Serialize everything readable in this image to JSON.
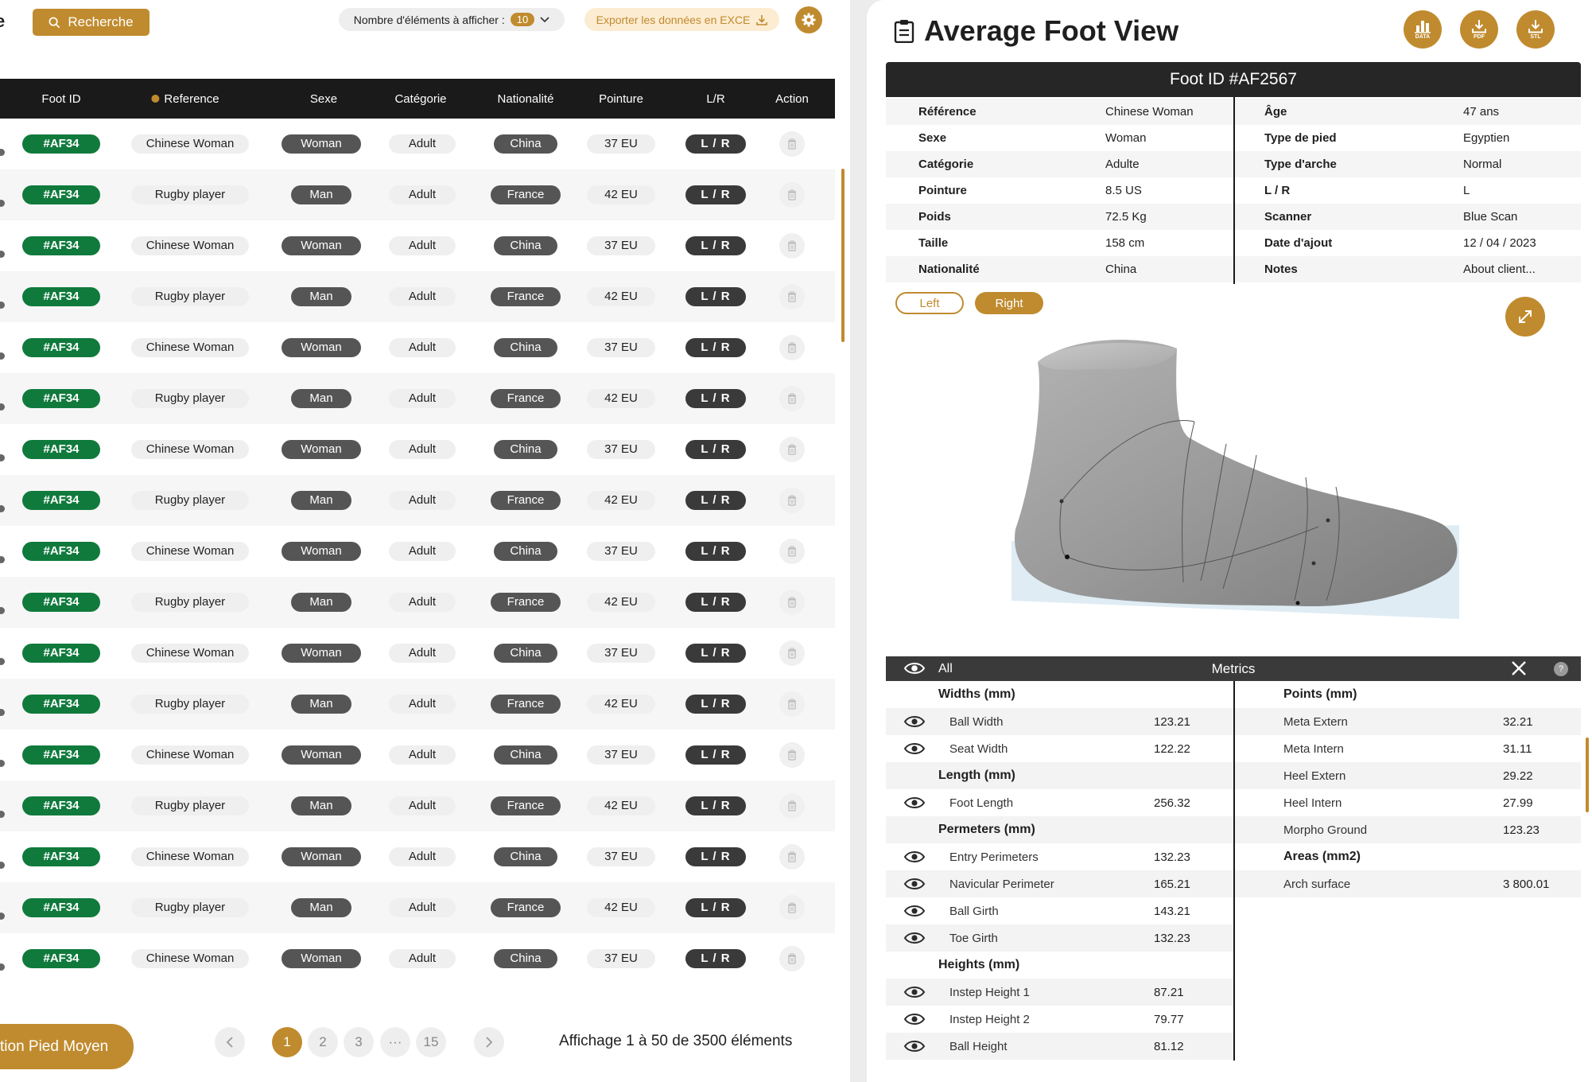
{
  "toolbar": {
    "title_fragment": "e",
    "search_label": "Recherche",
    "items_label": "Nombre d'éléments à afficher :",
    "items_value": "10",
    "export_label": "Exporter les données en EXCE"
  },
  "table": {
    "headers": [
      "Foot ID",
      "Reference",
      "Sexe",
      "Catégorie",
      "Nationalité",
      "Pointure",
      "L/R",
      "Action"
    ],
    "rows": [
      {
        "id": "#AF34",
        "ref": "Chinese Woman",
        "sex": "Woman",
        "cat": "Adult",
        "nat": "China",
        "size": "37 EU",
        "lr": "L / R"
      },
      {
        "id": "#AF34",
        "ref": "Rugby player",
        "sex": "Man",
        "cat": "Adult",
        "nat": "France",
        "size": "42 EU",
        "lr": "L / R"
      },
      {
        "id": "#AF34",
        "ref": "Chinese Woman",
        "sex": "Woman",
        "cat": "Adult",
        "nat": "China",
        "size": "37 EU",
        "lr": "L / R"
      },
      {
        "id": "#AF34",
        "ref": "Rugby player",
        "sex": "Man",
        "cat": "Adult",
        "nat": "France",
        "size": "42 EU",
        "lr": "L / R"
      },
      {
        "id": "#AF34",
        "ref": "Chinese Woman",
        "sex": "Woman",
        "cat": "Adult",
        "nat": "China",
        "size": "37 EU",
        "lr": "L / R"
      },
      {
        "id": "#AF34",
        "ref": "Rugby player",
        "sex": "Man",
        "cat": "Adult",
        "nat": "France",
        "size": "42 EU",
        "lr": "L / R"
      },
      {
        "id": "#AF34",
        "ref": "Chinese Woman",
        "sex": "Woman",
        "cat": "Adult",
        "nat": "China",
        "size": "37 EU",
        "lr": "L / R"
      },
      {
        "id": "#AF34",
        "ref": "Rugby player",
        "sex": "Man",
        "cat": "Adult",
        "nat": "France",
        "size": "42 EU",
        "lr": "L / R"
      },
      {
        "id": "#AF34",
        "ref": "Chinese Woman",
        "sex": "Woman",
        "cat": "Adult",
        "nat": "China",
        "size": "37 EU",
        "lr": "L / R"
      },
      {
        "id": "#AF34",
        "ref": "Rugby player",
        "sex": "Man",
        "cat": "Adult",
        "nat": "France",
        "size": "42 EU",
        "lr": "L / R"
      },
      {
        "id": "#AF34",
        "ref": "Chinese Woman",
        "sex": "Woman",
        "cat": "Adult",
        "nat": "China",
        "size": "37 EU",
        "lr": "L / R"
      },
      {
        "id": "#AF34",
        "ref": "Rugby player",
        "sex": "Man",
        "cat": "Adult",
        "nat": "France",
        "size": "42 EU",
        "lr": "L / R"
      },
      {
        "id": "#AF34",
        "ref": "Chinese Woman",
        "sex": "Woman",
        "cat": "Adult",
        "nat": "China",
        "size": "37 EU",
        "lr": "L / R"
      },
      {
        "id": "#AF34",
        "ref": "Rugby player",
        "sex": "Man",
        "cat": "Adult",
        "nat": "France",
        "size": "42 EU",
        "lr": "L / R"
      },
      {
        "id": "#AF34",
        "ref": "Chinese Woman",
        "sex": "Woman",
        "cat": "Adult",
        "nat": "China",
        "size": "37 EU",
        "lr": "L / R"
      },
      {
        "id": "#AF34",
        "ref": "Rugby player",
        "sex": "Man",
        "cat": "Adult",
        "nat": "France",
        "size": "42 EU",
        "lr": "L / R"
      },
      {
        "id": "#AF34",
        "ref": "Chinese Woman",
        "sex": "Woman",
        "cat": "Adult",
        "nat": "China",
        "size": "37 EU",
        "lr": "L / R"
      }
    ]
  },
  "pagination": {
    "action_label": "tion Pied Moyen",
    "pages": [
      "1",
      "2",
      "3",
      "···",
      "15"
    ],
    "current": "1",
    "info": "Affichage 1 à 50 de 3500 éléments"
  },
  "view": {
    "title": "Average Foot View",
    "buttons": [
      "DATA",
      "PDF",
      "STL"
    ],
    "foot_id": "Foot ID #AF2567",
    "left_fields": [
      {
        "k": "Référence",
        "v": "Chinese Woman"
      },
      {
        "k": "Sexe",
        "v": "Woman"
      },
      {
        "k": "Catégorie",
        "v": "Adulte"
      },
      {
        "k": "Pointure",
        "v": "8.5 US"
      },
      {
        "k": "Poids",
        "v": "72.5 Kg"
      },
      {
        "k": "Taille",
        "v": "158 cm"
      },
      {
        "k": "Nationalité",
        "v": "China"
      }
    ],
    "right_fields": [
      {
        "k": "Âge",
        "v": "47 ans"
      },
      {
        "k": "Type de pied",
        "v": "Egyptien"
      },
      {
        "k": "Type d'arche",
        "v": "Normal"
      },
      {
        "k": "L / R",
        "v": "L"
      },
      {
        "k": "Scanner",
        "v": "Blue Scan"
      },
      {
        "k": "Date d'ajout",
        "v": "12 / 04 / 2023"
      },
      {
        "k": "Notes",
        "v": "About client..."
      }
    ],
    "toggle_left": "Left",
    "toggle_right": "Right"
  },
  "metrics": {
    "all_label": "All",
    "title": "Metrics",
    "left": [
      {
        "h": "Widths (mm)"
      },
      {
        "k": "Ball Width",
        "v": "123.21"
      },
      {
        "k": "Seat Width",
        "v": "122.22"
      },
      {
        "h": "Length (mm)"
      },
      {
        "k": "Foot Length",
        "v": "256.32"
      },
      {
        "h": "Permeters (mm)"
      },
      {
        "k": "Entry Perimeters",
        "v": "132.23"
      },
      {
        "k": "Navicular Perimeter",
        "v": "165.21"
      },
      {
        "k": "Ball Girth",
        "v": "143.21"
      },
      {
        "k": "Toe Girth",
        "v": "132.23"
      },
      {
        "h": "Heights (mm)"
      },
      {
        "k": "Instep Height 1",
        "v": "87.21"
      },
      {
        "k": "Instep Height 2",
        "v": "79.77"
      },
      {
        "k": "Ball Height",
        "v": "81.12"
      }
    ],
    "right": [
      {
        "h": "Points (mm)"
      },
      {
        "k": "Meta Extern",
        "v": "32.21"
      },
      {
        "k": "Meta Intern",
        "v": "31.11"
      },
      {
        "k": "Heel Extern",
        "v": "29.22"
      },
      {
        "k": "Heel Intern",
        "v": "27.99"
      },
      {
        "k": "Morpho Ground",
        "v": "123.23"
      },
      {
        "h": "Areas (mm2)"
      },
      {
        "k": "Arch surface",
        "v": "3 800.01"
      }
    ]
  },
  "colors": {
    "accent": "#c08b2e",
    "id_green": "#0f7a3c",
    "dark": "#1a1a1a"
  }
}
